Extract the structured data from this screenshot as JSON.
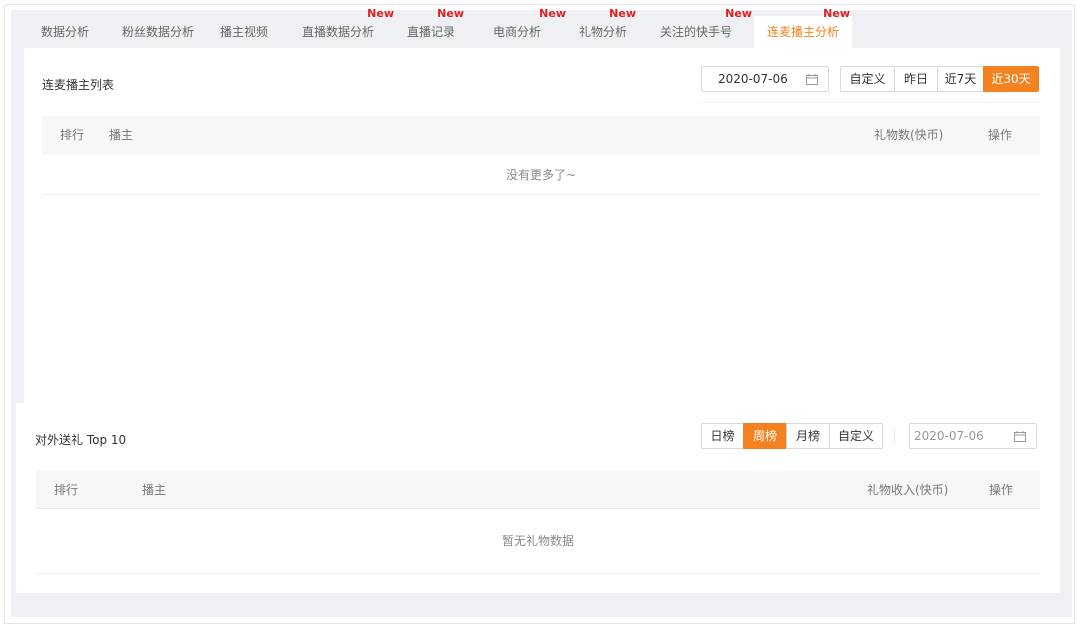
{
  "tabs": [
    {
      "label": "数据分析",
      "new": false,
      "active": false
    },
    {
      "label": "粉丝数据分析",
      "new": false,
      "active": false
    },
    {
      "label": "播主视频",
      "new": false,
      "active": false
    },
    {
      "label": "直播数据分析",
      "new": true,
      "active": false
    },
    {
      "label": "直播记录",
      "new": true,
      "active": false
    },
    {
      "label": "电商分析",
      "new": true,
      "active": false
    },
    {
      "label": "礼物分析",
      "new": true,
      "active": false
    },
    {
      "label": "关注的快手号",
      "new": true,
      "active": false
    },
    {
      "label": "连麦播主分析",
      "new": true,
      "active": true
    }
  ],
  "new_badge": "New",
  "section1": {
    "title": "连麦播主列表",
    "date": "2020-07-06",
    "ranges": [
      "自定义",
      "昨日",
      "近7天",
      "近30天"
    ],
    "active_range": "近30天",
    "columns": {
      "rank": "排行",
      "anchor": "播主",
      "gifts": "礼物数(快币)",
      "action": "操作"
    },
    "empty": "没有更多了~"
  },
  "section2": {
    "title": "对外送礼 Top 10",
    "periods": [
      "日榜",
      "周榜",
      "月榜",
      "自定义"
    ],
    "active_period": "周榜",
    "date_placeholder": "2020-07-06",
    "columns": {
      "rank": "排行",
      "anchor": "播主",
      "income": "礼物收入(快币)",
      "action": "操作"
    },
    "empty": "暂无礼物数据"
  },
  "colors": {
    "accent": "#f58220",
    "badge": "#e02020"
  }
}
